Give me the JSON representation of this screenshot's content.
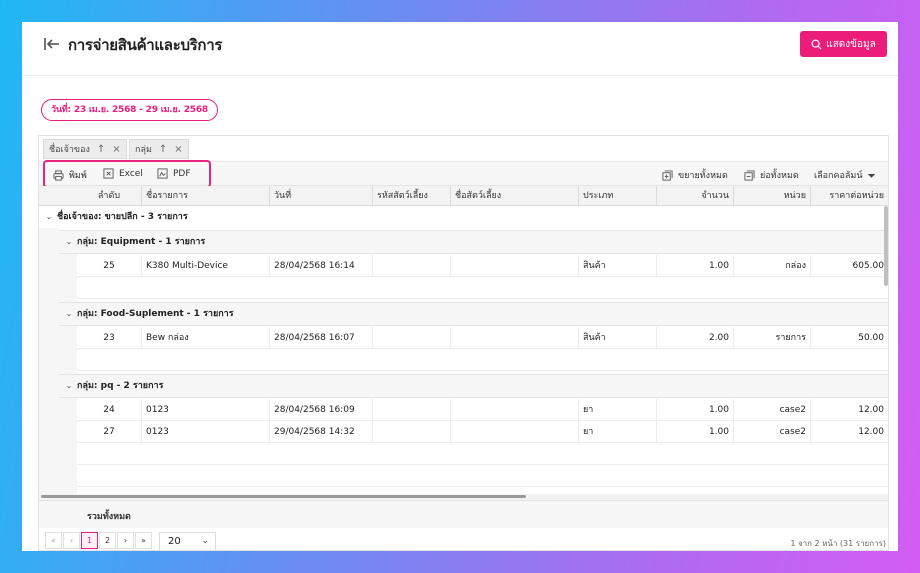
{
  "header": {
    "title": "การจ่ายสินค้าและบริการ",
    "show_button": "แสดงข้อมูล"
  },
  "filter": {
    "date_chip": "วันที่: 23 เม.ย. 2568 - 29 เม.ย. 2568"
  },
  "group_chips": [
    {
      "label": "ชื่อเจ้าของ",
      "sort": "↑",
      "close": "×"
    },
    {
      "label": "กลุ่ม",
      "sort": "↑",
      "close": "×"
    }
  ],
  "toolbar": {
    "print": "พิมพ์",
    "excel": "Excel",
    "pdf": "PDF",
    "expand_all": "ขยายทั้งหมด",
    "collapse_all": "ย่อทั้งหมด",
    "choose_columns": "เลือกคอลัมน์"
  },
  "columns": [
    "ลำดับ",
    "ชื่อรายการ",
    "วันที่",
    "รหัสสัตว์เลี้ยง",
    "ชื่อสัตว์เลี้ยง",
    "ประเภท",
    "จำนวน",
    "หน่วย",
    "ราคาต่อหน่วย"
  ],
  "owner_group": "ชื่อเจ้าของ: ขายปลีก - 3 รายการ",
  "groups": [
    {
      "label": "กลุ่ม: Equipment - 1 รายการ",
      "rows": [
        {
          "no": "25",
          "name": "K380 Multi-Device",
          "date": "28/04/2568 16:14",
          "pet_code": "",
          "pet_name": "",
          "type": "สินค้า",
          "qty": "1.00",
          "unit": "กล่อง",
          "price": "605.00"
        }
      ]
    },
    {
      "label": "กลุ่ม: Food-Suplement - 1 รายการ",
      "rows": [
        {
          "no": "23",
          "name": "Bew กล่อง",
          "date": "28/04/2568 16:07",
          "pet_code": "",
          "pet_name": "",
          "type": "สินค้า",
          "qty": "2.00",
          "unit": "รายการ",
          "price": "50.00"
        }
      ]
    },
    {
      "label": "กลุ่ม: pq - 2 รายการ",
      "rows": [
        {
          "no": "24",
          "name": "0123",
          "date": "28/04/2568 16:09",
          "pet_code": "",
          "pet_name": "",
          "type": "ยา",
          "qty": "1.00",
          "unit": "case2",
          "price": "12.00"
        },
        {
          "no": "27",
          "name": "0123",
          "date": "29/04/2568 14:32",
          "pet_code": "",
          "pet_name": "",
          "type": "ยา",
          "qty": "1.00",
          "unit": "case2",
          "price": "12.00"
        }
      ]
    }
  ],
  "summary": {
    "label": "รวมทั้งหมด"
  },
  "pager": {
    "first": "«",
    "prev": "‹",
    "pages": [
      "1",
      "2"
    ],
    "next": "›",
    "last": "»",
    "page_size": "20",
    "info": "1 จาก 2 หน้า (31 รายการ)"
  },
  "colors": {
    "accent": "#ec1c7a"
  }
}
